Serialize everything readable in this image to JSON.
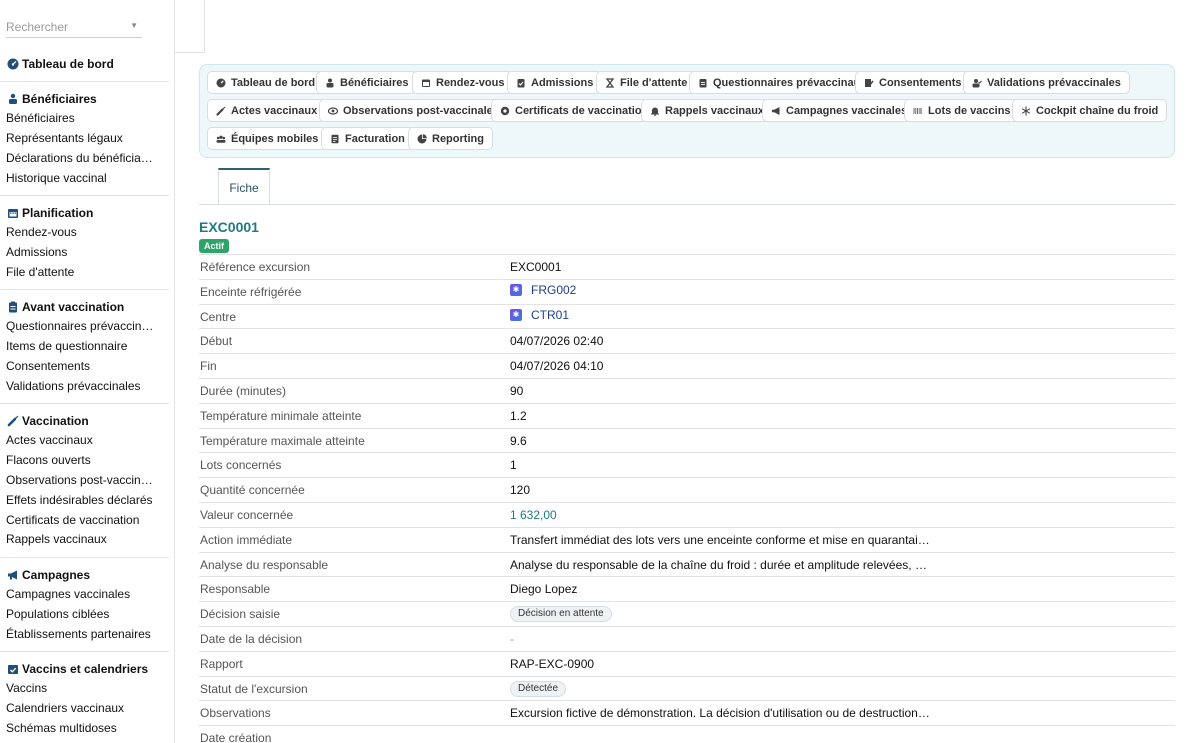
{
  "search": {
    "placeholder": "Rechercher"
  },
  "sidebar": {
    "dashboard": {
      "label": "Tableau de bord",
      "icon": "dashboard-icon"
    },
    "groups": [
      {
        "title": "Bénéficiaires",
        "icon": "users-icon",
        "items": [
          "Bénéficiaires",
          "Représentants légaux",
          "Déclarations du bénéficia…",
          "Historique vaccinal"
        ]
      },
      {
        "title": "Planification",
        "icon": "calendar-icon",
        "items": [
          "Rendez-vous",
          "Admissions",
          "File d'attente"
        ]
      },
      {
        "title": "Avant vaccination",
        "icon": "clipboard-icon",
        "items": [
          "Questionnaires prévaccin…",
          "Items de questionnaire",
          "Consentements",
          "Validations prévaccinales"
        ]
      },
      {
        "title": "Vaccination",
        "icon": "syringe-icon",
        "items": [
          "Actes vaccinaux",
          "Flacons ouverts",
          "Observations post-vaccin…",
          "Effets indésirables déclarés",
          "Certificats de vaccination",
          "Rappels vaccinaux"
        ]
      },
      {
        "title": "Campagnes",
        "icon": "megaphone-icon",
        "items": [
          "Campagnes vaccinales",
          "Populations ciblées",
          "Établissements partenaires"
        ]
      },
      {
        "title": "Vaccins et calendriers",
        "icon": "calendar-check-icon",
        "items": [
          "Vaccins",
          "Calendriers vaccinaux",
          "Schémas multidoses"
        ]
      }
    ]
  },
  "nav": [
    {
      "label": "Tableau de bord",
      "icon": "dashboard-icon"
    },
    {
      "label": "Bénéficiaires",
      "icon": "users-icon"
    },
    {
      "label": "Rendez-vous",
      "icon": "calendar-icon"
    },
    {
      "label": "Admissions",
      "icon": "clipboard-icon"
    },
    {
      "label": "File d'attente",
      "icon": "hourglass-icon"
    },
    {
      "label": "Questionnaires prévaccinaux",
      "icon": "clipboard-list-icon"
    },
    {
      "label": "Consentements",
      "icon": "signature-icon"
    },
    {
      "label": "Validations prévaccinales",
      "icon": "user-check-icon"
    },
    {
      "label": "Actes vaccinaux",
      "icon": "syringe-icon"
    },
    {
      "label": "Observations post-vaccinales",
      "icon": "eye-icon"
    },
    {
      "label": "Certificats de vaccination",
      "icon": "certificate-icon"
    },
    {
      "label": "Rappels vaccinaux",
      "icon": "bell-icon"
    },
    {
      "label": "Campagnes vaccinales",
      "icon": "megaphone-icon"
    },
    {
      "label": "Lots de vaccins",
      "icon": "barcode-icon"
    },
    {
      "label": "Cockpit chaîne du froid",
      "icon": "snowflake-icon"
    },
    {
      "label": "Équipes mobiles",
      "icon": "team-icon"
    },
    {
      "label": "Facturation",
      "icon": "invoice-icon"
    },
    {
      "label": "Reporting",
      "icon": "pie-chart-icon"
    }
  ],
  "tab": {
    "label": "Fiche"
  },
  "record": {
    "title": "EXC0001",
    "status_badge": "Actif",
    "fields": [
      {
        "label": "Référence excursion",
        "value": "EXC0001",
        "kind": "text"
      },
      {
        "label": "Enceinte réfrigérée",
        "value": "FRG002",
        "kind": "link"
      },
      {
        "label": "Centre",
        "value": "CTR01",
        "kind": "link"
      },
      {
        "label": "Début",
        "value": "04/07/2026 02:40",
        "kind": "text"
      },
      {
        "label": "Fin",
        "value": "04/07/2026 04:10",
        "kind": "text"
      },
      {
        "label": "Durée (minutes)",
        "value": "90",
        "kind": "text"
      },
      {
        "label": "Température minimale atteinte",
        "value": "1.2",
        "kind": "text"
      },
      {
        "label": "Température maximale atteinte",
        "value": "9.6",
        "kind": "text"
      },
      {
        "label": "Lots concernés",
        "value": "1",
        "kind": "text"
      },
      {
        "label": "Quantité concernée",
        "value": "120",
        "kind": "text"
      },
      {
        "label": "Valeur concernée",
        "value": "1 632,00",
        "kind": "money"
      },
      {
        "label": "Action immédiate",
        "value": "Transfert immédiat des lots vers une enceinte conforme et mise en quarantaine.",
        "kind": "text"
      },
      {
        "label": "Analyse du responsable",
        "value": "Analyse du responsable de la chaîne du froid : durée et amplitude relevées, cons…",
        "kind": "text"
      },
      {
        "label": "Responsable",
        "value": "Diego Lopez",
        "kind": "text"
      },
      {
        "label": "Décision saisie",
        "value": "Décision en attente",
        "kind": "chip"
      },
      {
        "label": "Date de la décision",
        "value": "-",
        "kind": "dash"
      },
      {
        "label": "Rapport",
        "value": "RAP-EXC-0900",
        "kind": "text"
      },
      {
        "label": "Statut de l'excursion",
        "value": "Détectée",
        "kind": "chip"
      },
      {
        "label": "Observations",
        "value": "Excursion fictive de démonstration. La décision d'utilisation ou de destruction …",
        "kind": "text"
      },
      {
        "label": "Date création",
        "value": "",
        "kind": "text"
      }
    ]
  }
}
